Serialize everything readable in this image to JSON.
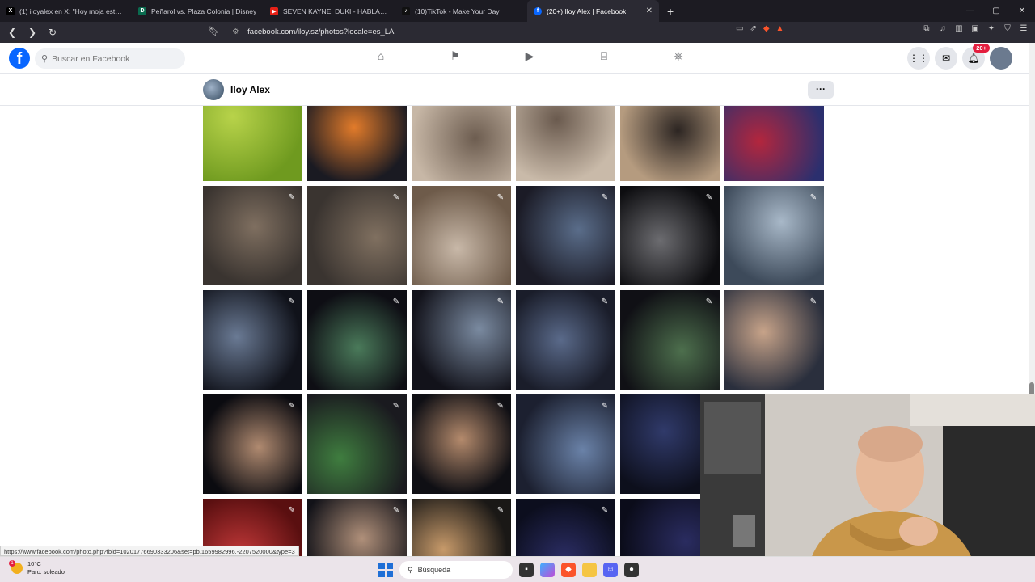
{
  "browser": {
    "tabs": [
      {
        "label": "(1) iloyalex en X: \"Hoy moja este pen",
        "icon": "x-icon",
        "active": false
      },
      {
        "label": "Peñarol vs. Plaza Colonia | Disney",
        "icon": "disney-icon",
        "active": false
      },
      {
        "label": "SEVEN KAYNE, DUKI - HABLAMOS P",
        "icon": "youtube-icon",
        "active": false
      },
      {
        "label": "(10)TikTok - Make Your Day",
        "icon": "tiktok-icon",
        "active": false
      },
      {
        "label": "(20+) Iloy Alex | Facebook",
        "icon": "facebook-icon",
        "active": true
      }
    ],
    "new_tab": "+",
    "url": "facebook.com/iloy.sz/photos?locale=es_LA"
  },
  "facebook": {
    "logo": "f",
    "search_placeholder": "Buscar en Facebook",
    "notifications_badge": "20+",
    "profile_name": "Iloy Alex",
    "more_label": "···"
  },
  "status_url": "https://www.facebook.com/photo.php?fbid=10201776690333206&set=pb.1659982996.-2207520000&type=3",
  "taskbar": {
    "temperature": "10°C",
    "condition": "Parc. soleado",
    "search_label": "Búsqueda"
  },
  "colors": {
    "fb_blue": "#0866ff",
    "tab_bg": "#1c1b22",
    "toolbar_bg": "#2b2a33",
    "notification_red": "#e41e3f"
  }
}
